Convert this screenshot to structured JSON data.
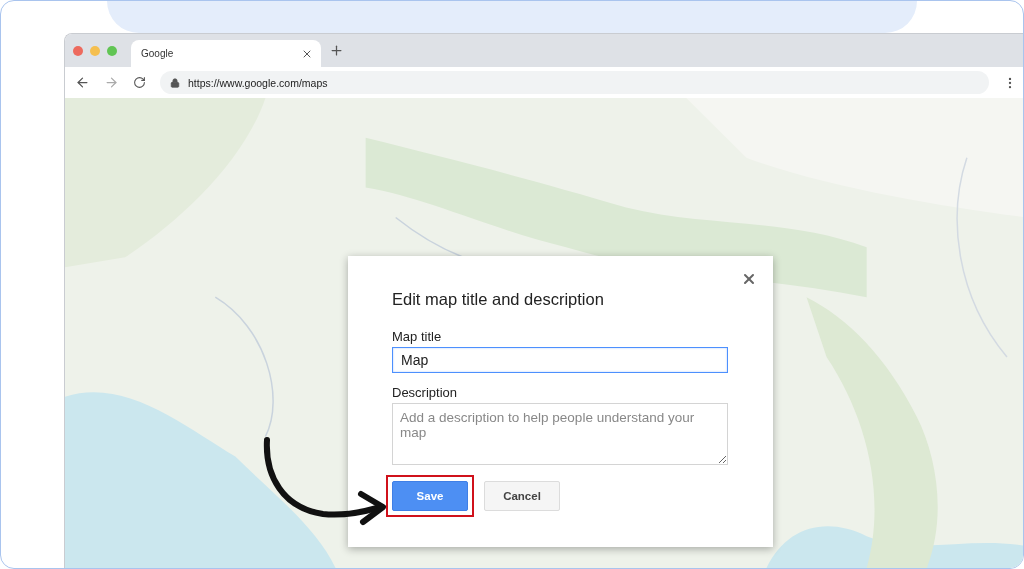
{
  "browser": {
    "tab": {
      "title": "Google"
    },
    "url": "https://www.google.com/maps"
  },
  "dialog": {
    "title": "Edit map title and description",
    "fields": [
      {
        "kind": "input",
        "label": "Map title",
        "value": "Map"
      },
      {
        "kind": "textarea",
        "label": "Description",
        "placeholder": "Add a description to help people understand your map"
      }
    ],
    "buttons": [
      {
        "label": "Save",
        "kind": "primary",
        "highlighted": true
      },
      {
        "label": "Cancel",
        "kind": "secondary",
        "highlighted": false
      }
    ]
  }
}
